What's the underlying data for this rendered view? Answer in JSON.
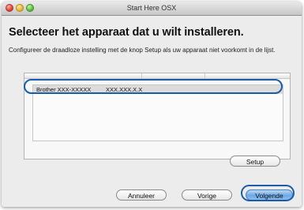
{
  "window": {
    "title": "Start Here OSX"
  },
  "main": {
    "heading": "Selecteer het apparaat dat u wilt installeren.",
    "instruction": "Configureer de draadloze instelling met de knop Setup als uw apparaat niet voorkomt in de lijst."
  },
  "device_list": {
    "rows": [
      {
        "name": "Brother XXX-XXXXX",
        "model": "XXX.XXX.X.X"
      }
    ]
  },
  "buttons": {
    "setup": "Setup",
    "cancel": "Annuleer",
    "back": "Vorige",
    "next": "Volgende"
  },
  "colors": {
    "highlight": "#1a5ca8",
    "default_button": "#6ea8e6"
  }
}
